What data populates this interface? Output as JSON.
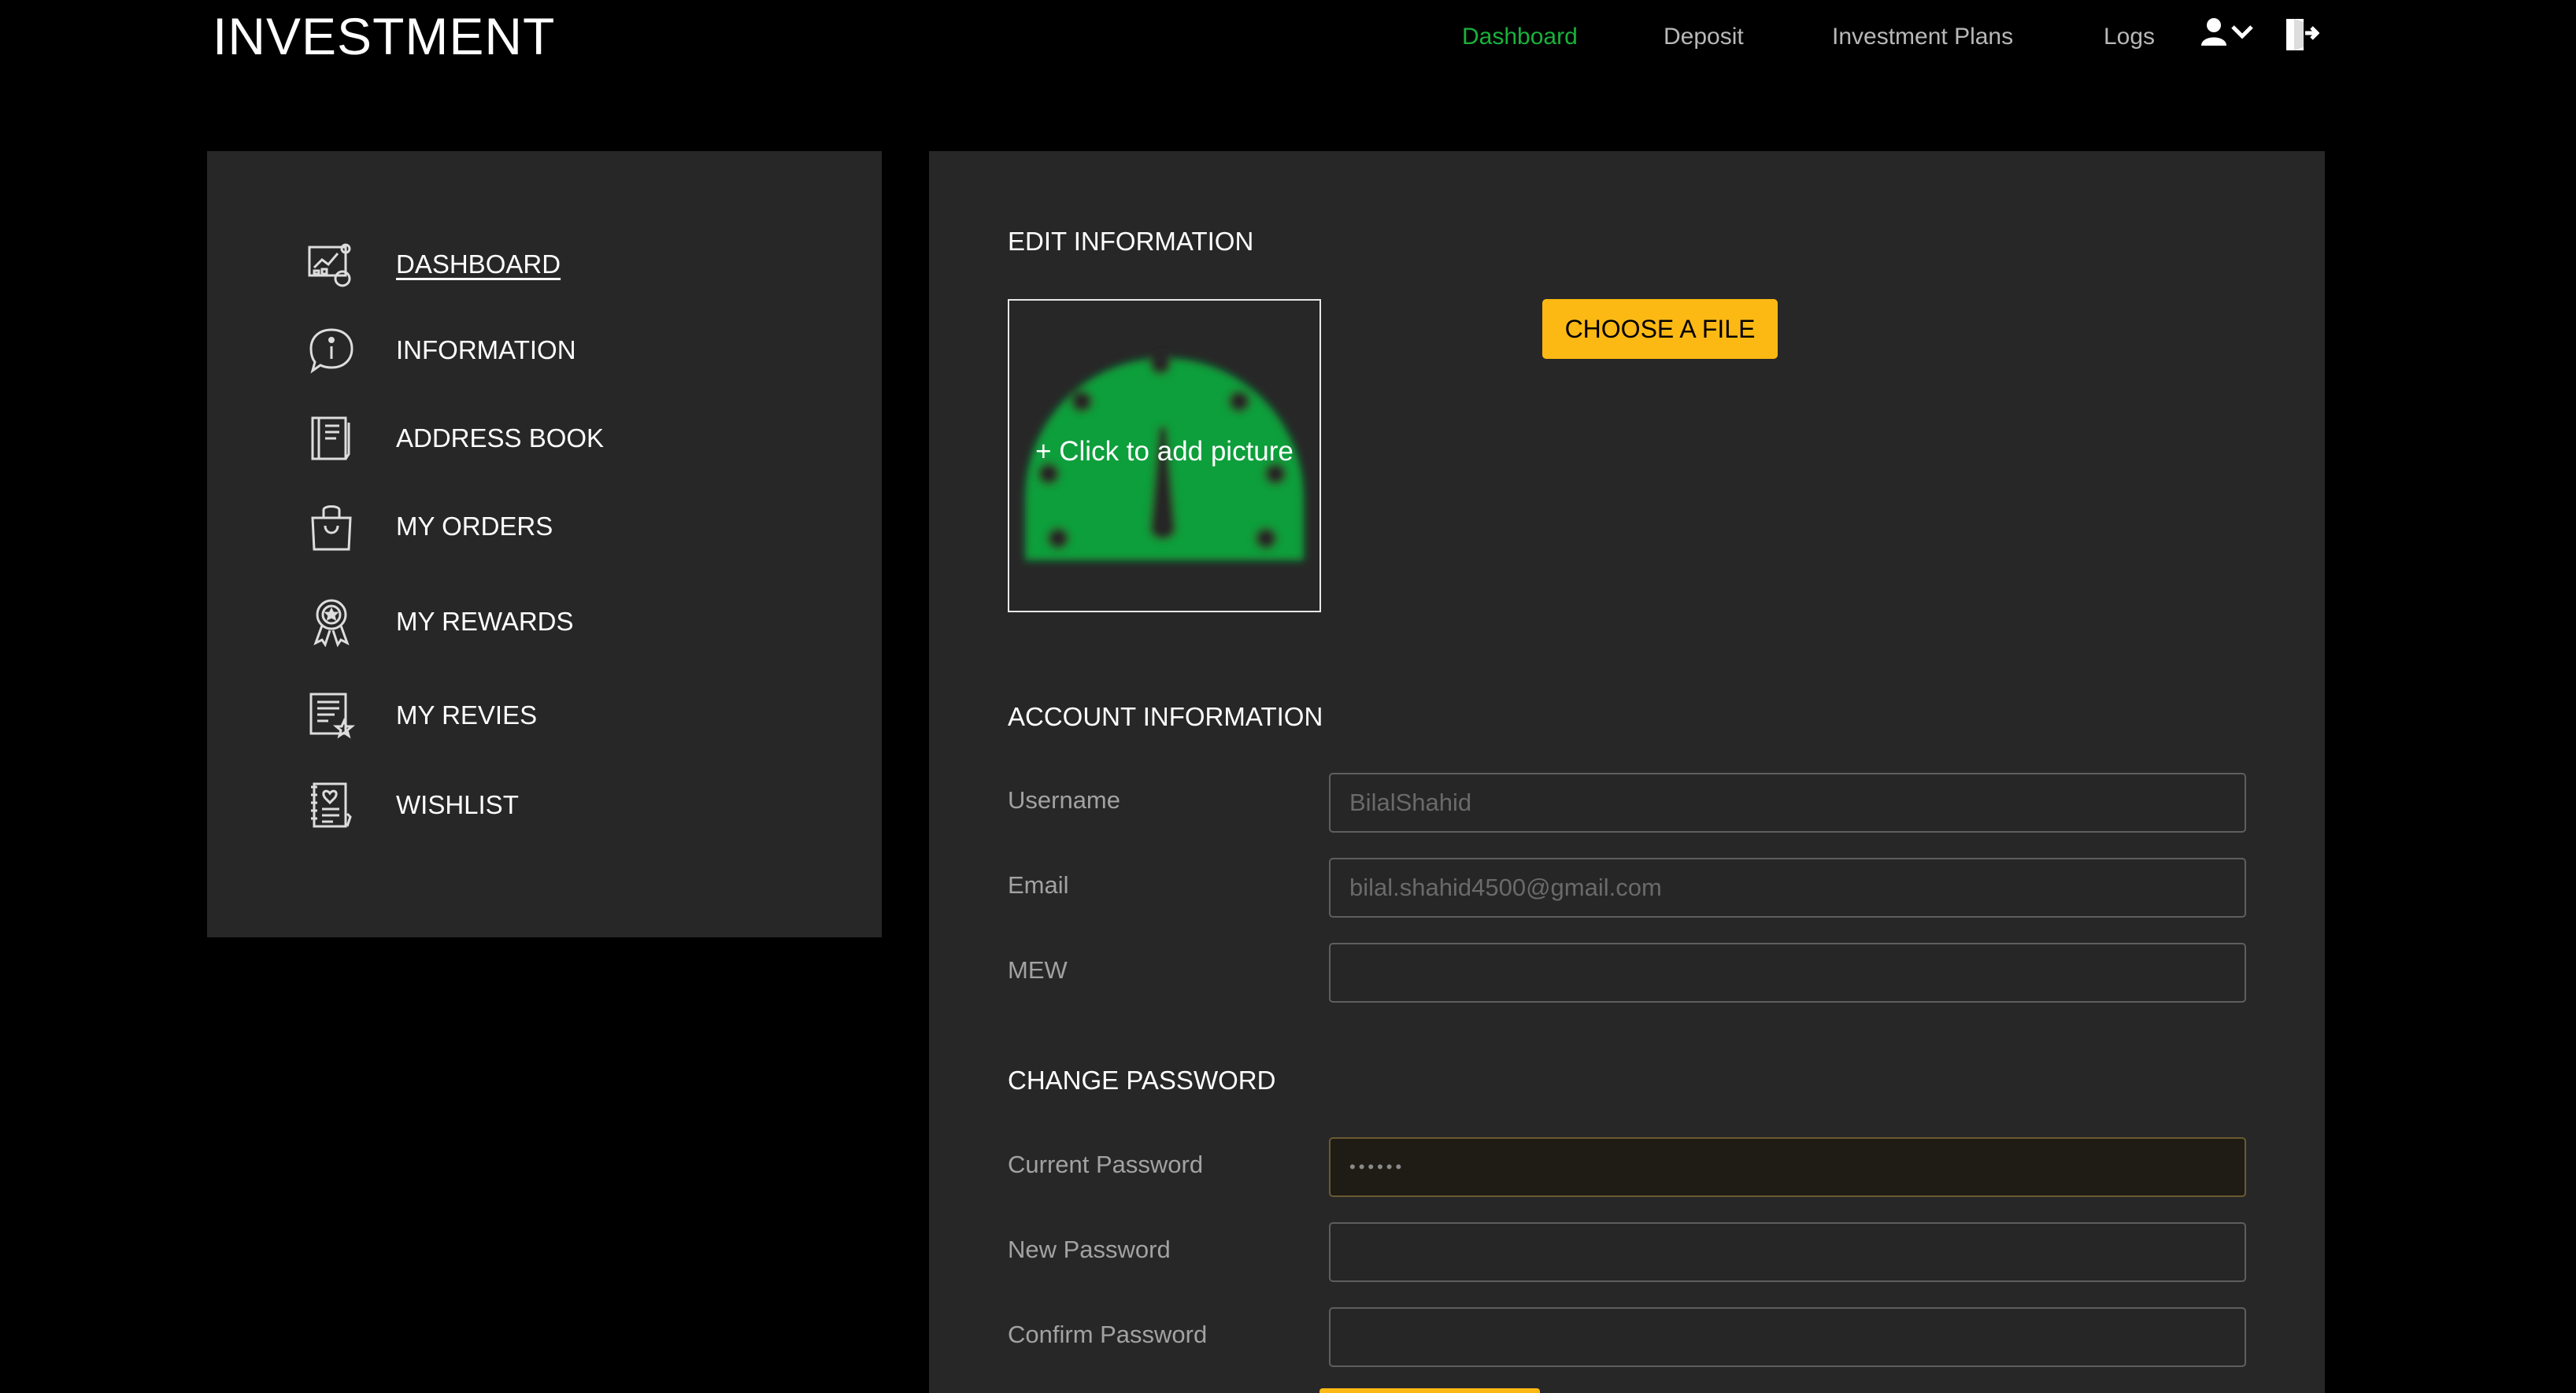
{
  "brand": "INVESTMENT",
  "nav": {
    "links": [
      "Dashboard",
      "Deposit",
      "Investment Plans",
      "Logs"
    ],
    "active": "Dashboard",
    "user_icon": "user-dropdown-icon",
    "logout_icon": "logout-icon"
  },
  "sidebar": {
    "items": [
      {
        "label": "DASHBOARD",
        "icon": "dashboard-icon"
      },
      {
        "label": "INFORMATION",
        "icon": "info-icon"
      },
      {
        "label": "ADDRESS BOOK",
        "icon": "address-book-icon"
      },
      {
        "label": "MY ORDERS",
        "icon": "shopping-bag-icon"
      },
      {
        "label": "MY REWARDS",
        "icon": "award-icon"
      },
      {
        "label": "MY REVIES",
        "icon": "review-icon"
      },
      {
        "label": "WISHLIST",
        "icon": "wishlist-icon"
      }
    ]
  },
  "edit": {
    "title": "EDIT INFORMATION",
    "picture_hint": "+ Click to add picture",
    "choose_file": "CHOOSE A FILE"
  },
  "account": {
    "title": "ACCOUNT INFORMATION",
    "username_label": "Username",
    "username_placeholder": "BilalShahid",
    "email_label": "Email",
    "email_placeholder": "bilal.shahid4500@gmail.com",
    "mew_label": "MEW",
    "mew_value": ""
  },
  "password": {
    "title": "CHANGE PASSWORD",
    "current_label": "Current Password",
    "current_value": "••••••",
    "new_label": "New Password",
    "confirm_label": "Confirm Password"
  },
  "colors": {
    "accent_green": "#19b23b",
    "button_yellow": "#fdb913",
    "panel_bg": "#272727",
    "page_bg": "#000000"
  }
}
